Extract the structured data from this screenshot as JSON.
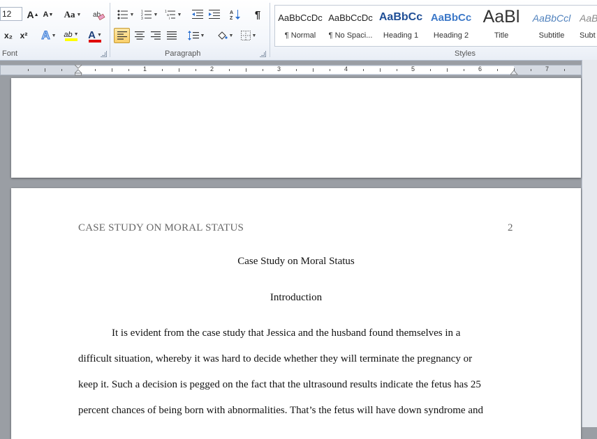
{
  "ribbon": {
    "font_size_value": "12",
    "groups": {
      "font": "Font",
      "paragraph": "Paragraph",
      "styles": "Styles"
    },
    "buttons": {
      "grow_font": "A",
      "shrink_font": "A",
      "change_case": "Aa",
      "subscript": "x₂",
      "superscript": "x²",
      "text_effects": "A",
      "highlight": "ab",
      "font_color": "A",
      "pilcrow": "¶"
    },
    "styles": [
      {
        "sample": "AaBbCcDc",
        "name": "¶ Normal"
      },
      {
        "sample": "AaBbCcDc",
        "name": "¶ No Spaci..."
      },
      {
        "sample": "AaBbCc",
        "name": "Heading 1"
      },
      {
        "sample": "AaBbCc",
        "name": "Heading 2"
      },
      {
        "sample": "AaBl",
        "name": "Title"
      },
      {
        "sample": "AaBbCcl",
        "name": "Subtitle"
      },
      {
        "sample": "AaBl",
        "name": "Subt"
      }
    ],
    "colors": {
      "highlight": "#ffff00",
      "font_color": "#e00000",
      "heading": "#1f4e96",
      "active": "#f9cf6a"
    }
  },
  "ruler": {
    "numbers": [
      "1",
      "2",
      "3",
      "4",
      "5",
      "6",
      "7"
    ]
  },
  "document": {
    "running_head": "CASE STUDY ON MORAL STATUS",
    "page_number": "2",
    "title": "Case Study on Moral Status",
    "section_heading": "Introduction",
    "body_lines": [
      "It is evident from the case study that Jessica and the husband found themselves in a",
      "difficult situation, whereby it was hard to decide whether they will terminate the pregnancy or",
      "keep it. Such a decision is pegged on the fact that the ultrasound results indicate the fetus has 25",
      "percent chances of being born with abnormalities.  That’s the fetus will have down syndrome and"
    ]
  }
}
